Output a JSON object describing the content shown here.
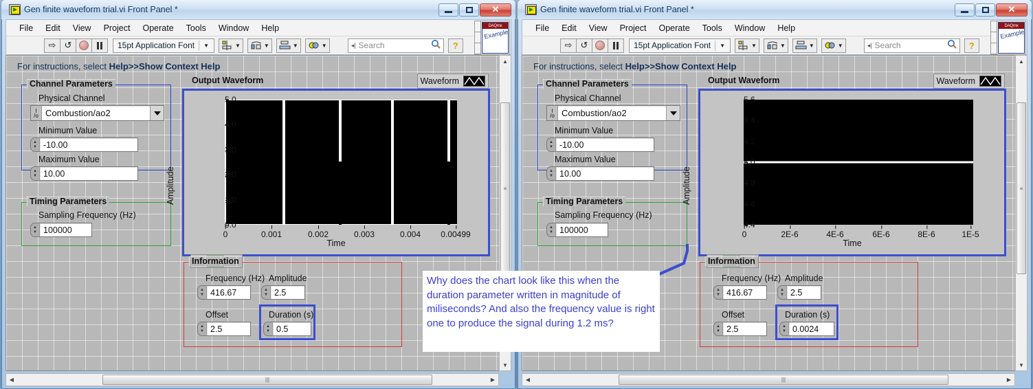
{
  "windows": [
    {
      "id": "left",
      "title": "Gen finite waveform trial.vi Front Panel *",
      "menu": [
        "File",
        "Edit",
        "View",
        "Project",
        "Operate",
        "Tools",
        "Window",
        "Help"
      ],
      "toolbar": {
        "run_label": "run-arrow",
        "run_cont_label": "run-continuously",
        "abort_label": "abort",
        "pause_label": "pause",
        "font_label": "15pt Application Font",
        "search_placeholder": "Search",
        "help_label": "?",
        "example_badge": "DAQmx",
        "example_text": "Example"
      },
      "instructions_prefix": "For instructions, select ",
      "instructions_bold": "Help>>Show Context Help",
      "channel_group": {
        "title": "Channel Parameters",
        "physical_channel_label": "Physical Channel",
        "physical_channel_value": "Combustion/ao2",
        "minimum_label": "Minimum Value",
        "minimum_value": "-10.00",
        "maximum_label": "Maximum Value",
        "maximum_value": "10.00"
      },
      "timing_group": {
        "title": "Timing Parameters",
        "sampling_label": "Sampling Frequency (Hz)",
        "sampling_value": "100000"
      },
      "information_group": {
        "title": "Information",
        "frequency_label": "Frequency (Hz)",
        "frequency_value": "416.67",
        "amplitude_label": "Amplitude",
        "amplitude_value": "2.5",
        "offset_label": "Offset",
        "offset_value": "2.5",
        "duration_label": "Duration (s)",
        "duration_value": "0.5"
      },
      "graph": {
        "title": "Output Waveform",
        "legend_label": "Waveform"
      },
      "chart_index": 0
    },
    {
      "id": "right",
      "title": "Gen finite waveform trial.vi Front Panel *",
      "menu": [
        "File",
        "Edit",
        "View",
        "Project",
        "Operate",
        "Tools",
        "Window",
        "Help"
      ],
      "toolbar": {
        "run_label": "run-arrow",
        "run_cont_label": "run-continuously",
        "abort_label": "abort",
        "pause_label": "pause",
        "font_label": "15pt Application Font",
        "search_placeholder": "Search",
        "help_label": "?",
        "example_badge": "DAQmx",
        "example_text": "Example"
      },
      "instructions_prefix": "For instructions, select ",
      "instructions_bold": "Help>>Show Context Help",
      "channel_group": {
        "title": "Channel Parameters",
        "physical_channel_label": "Physical Channel",
        "physical_channel_value": "Combustion/ao2",
        "minimum_label": "Minimum Value",
        "minimum_value": "-10.00",
        "maximum_label": "Maximum Value",
        "maximum_value": "10.00"
      },
      "timing_group": {
        "title": "Timing Parameters",
        "sampling_label": "Sampling Frequency (Hz)",
        "sampling_value": "100000"
      },
      "information_group": {
        "title": "Information",
        "frequency_label": "Frequency (Hz)",
        "frequency_value": "416.67",
        "amplitude_label": "Amplitude",
        "amplitude_value": "2.5",
        "offset_label": "Offset",
        "offset_value": "2.5",
        "duration_label": "Duration (s)",
        "duration_value": "0.0024"
      },
      "graph": {
        "title": "Output Waveform",
        "legend_label": "Waveform"
      },
      "chart_index": 1
    }
  ],
  "window_buttons": {
    "minimize": "minimize",
    "maximize": "maximize",
    "close": "✕"
  },
  "graph_palette": {
    "cursor_tool": "crosshair-cursor-tool",
    "zoom_tool": "zoom-tool",
    "pan_tool": "pan-hand-tool"
  },
  "annotation": {
    "text": "Why does the chart look like this when the duration parameter written in magnitude of miliseconds? And also the frequency value is right one to produce the signal during 1.2 ms?",
    "color": "#3b3fd0"
  },
  "colors": {
    "plot_background": "#000000",
    "trace": "#ffffff",
    "graph_border": "#3b4fce",
    "channel_group_border": "#2c3fcf",
    "timing_group_border": "#2fa33a",
    "information_group_border": "#d63b3b",
    "highlight_border": "#3b4fce",
    "canvas_background": "#b8b8b8"
  },
  "chart_data": [
    {
      "type": "line",
      "title": "Output Waveform",
      "xlabel": "Time",
      "ylabel": "Amplitude",
      "legend": [
        "Waveform"
      ],
      "legend_position": "top-right",
      "grid": false,
      "xlim": [
        0,
        0.00499
      ],
      "ylim": [
        0.0,
        5.0
      ],
      "xticks": [
        "0",
        "0.001",
        "0.002",
        "0.003",
        "0.004",
        "0.00499"
      ],
      "xtick_values": [
        0,
        0.001,
        0.002,
        0.003,
        0.004,
        0.00499
      ],
      "yticks": [
        "0.0",
        "1.0",
        "2.0",
        "3.0",
        "4.0",
        "5.0"
      ],
      "ytick_values": [
        0.0,
        1.0,
        2.0,
        3.0,
        4.0,
        5.0
      ],
      "note": "Aliased sine wave: 416.67 Hz signal rendered over 0.00499 s window appears as solid black fill with white vertical envelope edges; moire beat gaps visible.",
      "envelope_gaps_x": [
        0.00125,
        0.00245,
        0.0036,
        0.00485
      ],
      "gap_partial_depth": [
        5.0,
        2.5,
        5.0,
        2.5
      ]
    },
    {
      "type": "line",
      "title": "Output Waveform",
      "xlabel": "Time",
      "ylabel": "Amplitude",
      "legend": [
        "Waveform"
      ],
      "legend_position": "top-right",
      "grid": false,
      "xlim": [
        0,
        1e-05
      ],
      "ylim": [
        4.4,
        5.6
      ],
      "xticks": [
        "0",
        "2E-6",
        "4E-6",
        "6E-6",
        "8E-6",
        "1E-5"
      ],
      "xtick_values": [
        0,
        2e-06,
        4e-06,
        6e-06,
        8e-06,
        1e-05
      ],
      "yticks": [
        "4.4",
        "4.6",
        "4.8",
        "5.0",
        "5.2",
        "5.4",
        "5.6"
      ],
      "ytick_values": [
        4.4,
        4.6,
        4.8,
        5.0,
        5.2,
        5.4,
        5.6
      ],
      "series": [
        {
          "name": "Waveform",
          "constant_value": 5.0
        }
      ],
      "note": "Flat horizontal trace at amplitude 5.0 across the full 0 to 1E-5 s window."
    }
  ]
}
